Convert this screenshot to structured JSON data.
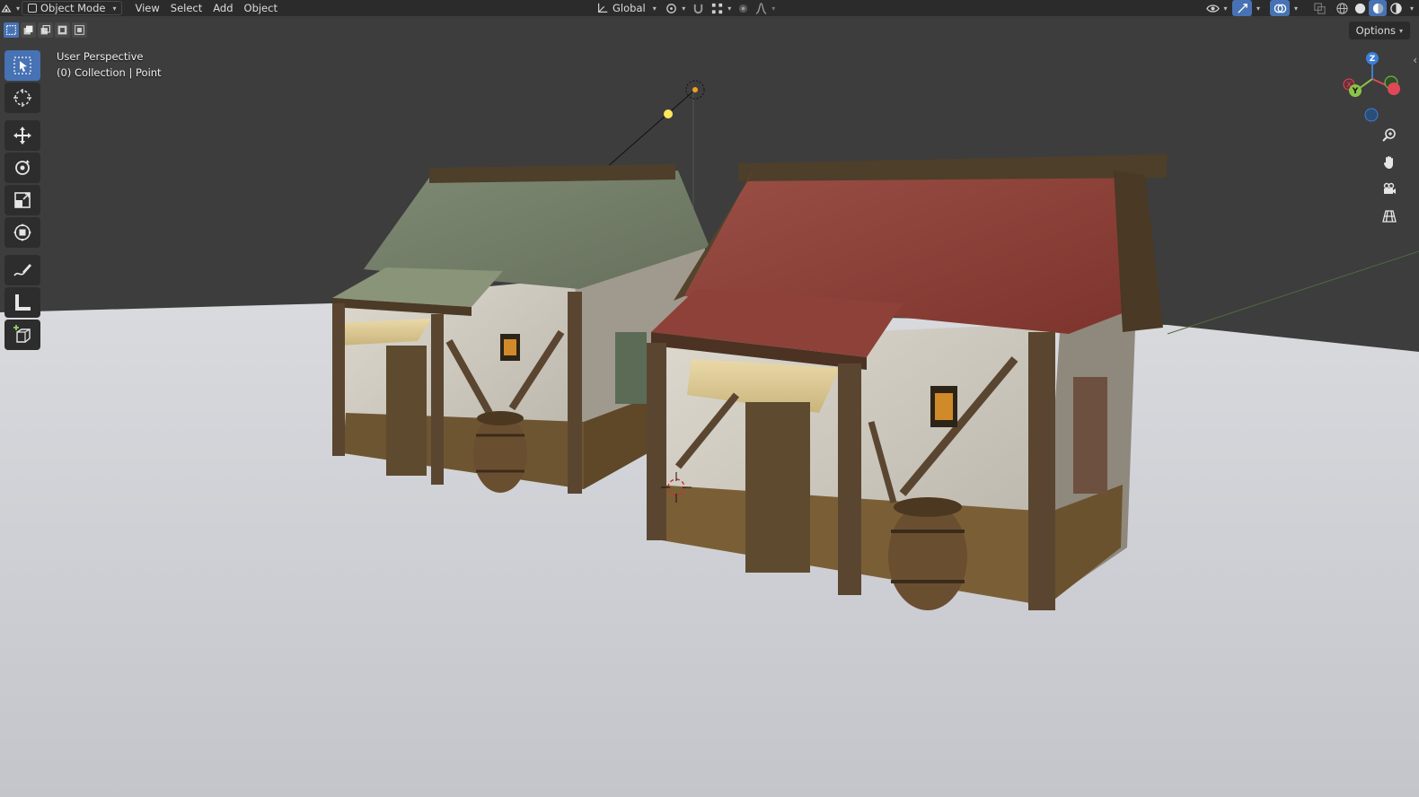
{
  "header": {
    "editor_type_icon": "editor-type-icon",
    "mode_label": "Object Mode",
    "menus": [
      "View",
      "Select",
      "Add",
      "Object"
    ],
    "orientation_label": "Global"
  },
  "viewport": {
    "perspective_label": "User Perspective",
    "collection_label": "(0) Collection | Point",
    "options_label": "Options"
  },
  "gizmo": {
    "x_label": "X",
    "y_label": "Y",
    "z_label": "Z"
  },
  "toolbar": {
    "tools": [
      "select-box",
      "cursor",
      "move",
      "rotate",
      "scale",
      "transform",
      "annotate",
      "measure",
      "add-cube"
    ],
    "active_tool": "select-box"
  },
  "colors": {
    "header_bg": "#2b2b2b",
    "background": "#3d3d3d",
    "floor": "#c9cbd0",
    "active_blue": "#4772b3",
    "axis_x": "#e04858",
    "axis_y": "#8bc34a",
    "axis_z": "#3d7fd8"
  }
}
